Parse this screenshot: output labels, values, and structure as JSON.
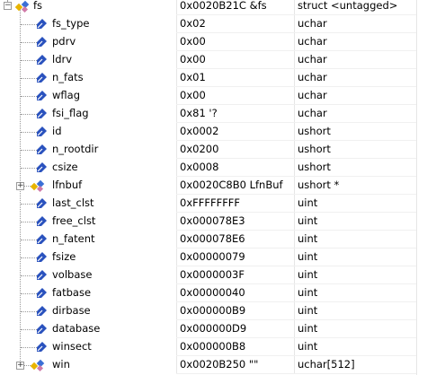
{
  "watch": {
    "root": {
      "name": "fs",
      "value": "0x0020B21C &fs",
      "type": "struct <untagged>",
      "icon": "struct-icon",
      "expanded": true
    },
    "members": [
      {
        "name": "fs_type",
        "value": "0x02",
        "type": "uchar",
        "icon": "field-icon",
        "expandable": false
      },
      {
        "name": "pdrv",
        "value": "0x00",
        "type": "uchar",
        "icon": "field-icon",
        "expandable": false
      },
      {
        "name": "ldrv",
        "value": "0x00",
        "type": "uchar",
        "icon": "field-icon",
        "expandable": false
      },
      {
        "name": "n_fats",
        "value": "0x01",
        "type": "uchar",
        "icon": "field-icon",
        "expandable": false
      },
      {
        "name": "wflag",
        "value": "0x00",
        "type": "uchar",
        "icon": "field-icon",
        "expandable": false
      },
      {
        "name": "fsi_flag",
        "value": "0x81 '?",
        "type": "uchar",
        "icon": "field-icon",
        "expandable": false
      },
      {
        "name": "id",
        "value": "0x0002",
        "type": "ushort",
        "icon": "field-icon",
        "expandable": false
      },
      {
        "name": "n_rootdir",
        "value": "0x0200",
        "type": "ushort",
        "icon": "field-icon",
        "expandable": false
      },
      {
        "name": "csize",
        "value": "0x0008",
        "type": "ushort",
        "icon": "field-icon",
        "expandable": false
      },
      {
        "name": "lfnbuf",
        "value": "0x0020C8B0 LfnBuf",
        "type": "ushort *",
        "icon": "struct-icon",
        "expandable": true
      },
      {
        "name": "last_clst",
        "value": "0xFFFFFFFF",
        "type": "uint",
        "icon": "field-icon",
        "expandable": false
      },
      {
        "name": "free_clst",
        "value": "0x000078E3",
        "type": "uint",
        "icon": "field-icon",
        "expandable": false
      },
      {
        "name": "n_fatent",
        "value": "0x000078E6",
        "type": "uint",
        "icon": "field-icon",
        "expandable": false
      },
      {
        "name": "fsize",
        "value": "0x00000079",
        "type": "uint",
        "icon": "field-icon",
        "expandable": false
      },
      {
        "name": "volbase",
        "value": "0x0000003F",
        "type": "uint",
        "icon": "field-icon",
        "expandable": false
      },
      {
        "name": "fatbase",
        "value": "0x00000040",
        "type": "uint",
        "icon": "field-icon",
        "expandable": false
      },
      {
        "name": "dirbase",
        "value": "0x000000B9",
        "type": "uint",
        "icon": "field-icon",
        "expandable": false
      },
      {
        "name": "database",
        "value": "0x000000D9",
        "type": "uint",
        "icon": "field-icon",
        "expandable": false
      },
      {
        "name": "winsect",
        "value": "0x000000B8",
        "type": "uint",
        "icon": "field-icon",
        "expandable": false
      },
      {
        "name": "win",
        "value": "0x0020B250 \"\"",
        "type": "uchar[512]",
        "icon": "struct-icon",
        "expandable": true
      }
    ]
  },
  "colors": {
    "field_icon": "#2a52be",
    "struct_yellow": "#e8b400",
    "struct_blue": "#3b6fd6",
    "struct_pink": "#d07aa8"
  }
}
